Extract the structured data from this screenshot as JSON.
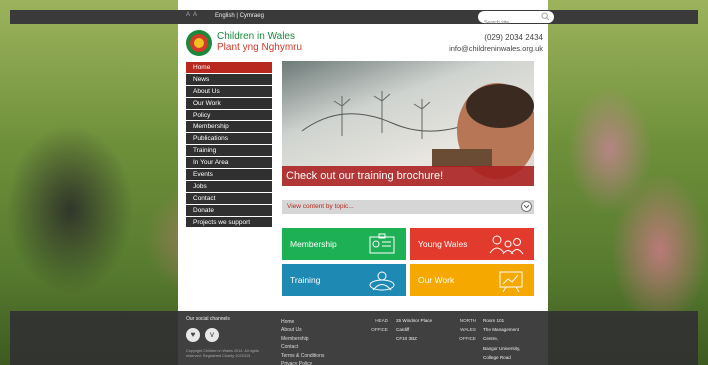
{
  "topbar": {
    "font_size_toggle": "A A",
    "language": "English | Cymraeg",
    "search_placeholder": "Search site"
  },
  "header": {
    "brand_en": "Children in Wales",
    "brand_cy": "Plant yng Nghymru",
    "phone": "(029) 2034 2434",
    "email": "info@childreninwales.org.uk"
  },
  "nav": {
    "items": [
      "Home",
      "News",
      "About Us",
      "Our Work",
      "Policy",
      "Membership",
      "Publications",
      "Training",
      "In Your Area",
      "Events",
      "Jobs",
      "Contact",
      "Donate",
      "Projects we support"
    ],
    "active": "Home"
  },
  "hero": {
    "caption": "Check out our training brochure!"
  },
  "topic": {
    "label": "View content by topic..."
  },
  "tiles": {
    "membership": "Membership",
    "young_wales": "Young Wales",
    "training": "Training",
    "our_work": "Our Work"
  },
  "footer": {
    "social_title": "Our social channels",
    "copyright": "Copyright Children in Wales 2014. All rights reserved. Registered Charity 1020313",
    "links": [
      "Home",
      "About Us",
      "Membership",
      "Contact",
      "Terms & Conditions",
      "Privacy Policy"
    ],
    "head_office_label": [
      "HEAD",
      "OFFICE"
    ],
    "head_office_address": [
      "25 Windsor Place",
      "Cardiff",
      "CF10 3BZ"
    ],
    "north_office_label": [
      "NORTH",
      "WALES",
      "OFFICE"
    ],
    "north_office_address": [
      "Room 101",
      "The Management",
      "Centre,",
      "Bangor University,",
      "College Road"
    ]
  },
  "colors": {
    "brand_green": "#1a8a3a",
    "brand_red": "#d23a2a",
    "nav_active": "#b8281e",
    "tile_membership": "#1db055",
    "tile_young_wales": "#e23a2c",
    "tile_training": "#1e8ab4",
    "tile_our_work": "#f5a800"
  },
  "icons": {
    "social": [
      "twitter-icon",
      "vimeo-icon"
    ],
    "tiles": [
      "membership-card-icon",
      "group-icon",
      "people-circle-icon",
      "chart-board-icon"
    ]
  }
}
